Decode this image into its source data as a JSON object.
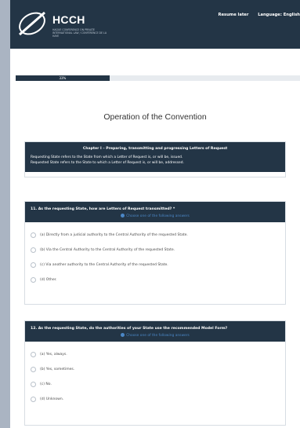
{
  "header": {
    "brand": "HCCH",
    "brand_sub": "HAGUE CONFERENCE ON PRIVATE INTERNATIONAL LAW / CONFÉRENCE DE LA HAYE",
    "resume_later": "Resume later",
    "language": "Language: English"
  },
  "progress": {
    "label": "33%",
    "fraction": 0.33
  },
  "page_title": "Operation of the Convention",
  "chapter": {
    "title": "Chapter I – Preparing, transmitting and progressing Letters of Request",
    "lines": [
      "Requesting State refers to the State from which a Letter of Request is, or will be, issued.",
      "Requested State refers to the State to which a Letter of Request is, or will be, addressed."
    ]
  },
  "questions": [
    {
      "title": "11. As the requesting State, how are Letters of Request transmitted? *",
      "hint": "Choose one of the following answers",
      "options": [
        "(a) Directly from a judicial authority to the Central Authority of the requested State.",
        "(b) Via the Central Authority to the Central Authority of the requested State.",
        "(c) Via another authority to the Central Authority of the requested State.",
        "(d) Other."
      ]
    },
    {
      "title": "12. As the requesting State, do the authorities of your State use the recommended Model Form?",
      "hint": "Choose one of the following answers",
      "options": [
        "(a) Yes, always.",
        "(b) Yes, sometimes.",
        "(c) No.",
        "(d) Unknown."
      ]
    }
  ],
  "colors": {
    "header_bg": "#233546",
    "hint": "#4b87c6",
    "page_bg": "#aab4c2"
  }
}
